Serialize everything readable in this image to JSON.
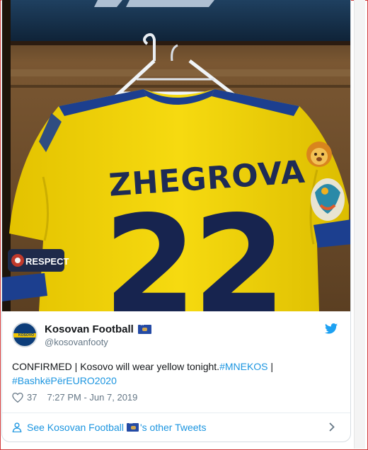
{
  "media": {
    "shirt_name": "ZHEGROVA",
    "shirt_number": "22",
    "patch_text": "RESPECT",
    "shirt_color": "#f3d400",
    "trim_color": "#1c3f8f",
    "emoji": "lion"
  },
  "author": {
    "display_name": "Kosovan Football",
    "handle": "@kosovanfooty",
    "avatar_icon": "kosovo-federation-logo",
    "flag_icon": "kosovo-flag"
  },
  "tweet": {
    "text_plain": "CONFIRMED | Kosovo will wear yellow tonight.",
    "hashtag_1": "#MNEKOS",
    "separator": " |",
    "hashtag_2": "#BashkëPërEURO2020",
    "link_color": "#1b95e0"
  },
  "meta": {
    "likes": "37",
    "timestamp": "7:27 PM - Jun 7, 2019"
  },
  "footer": {
    "link_prefix": "See Kosovan Football",
    "link_suffix": "'s other Tweets"
  }
}
